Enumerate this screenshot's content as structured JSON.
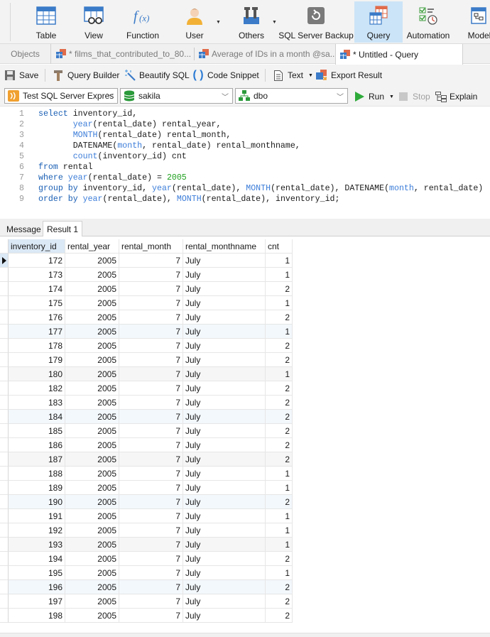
{
  "ribbon": {
    "items": [
      {
        "label": "Table",
        "icon": "table-icon"
      },
      {
        "label": "View",
        "icon": "view-icon"
      },
      {
        "label": "Function",
        "icon": "function-icon"
      },
      {
        "label": "User",
        "icon": "user-icon"
      },
      {
        "label": "Others",
        "icon": "others-icon"
      },
      {
        "label": "SQL Server Backup",
        "icon": "backup-icon"
      },
      {
        "label": "Query",
        "icon": "query-icon"
      },
      {
        "label": "Automation",
        "icon": "automation-icon"
      },
      {
        "label": "Model",
        "icon": "model-icon"
      }
    ],
    "active": "Query"
  },
  "tabs": {
    "objects": "Objects",
    "items": [
      {
        "label": "* films_that_contributed_to_80..."
      },
      {
        "label": "Average of IDs in a month @sa..."
      },
      {
        "label": "* Untitled - Query"
      }
    ]
  },
  "toolbar": {
    "save": "Save",
    "query_builder": "Query Builder",
    "beautify": "Beautify SQL",
    "snippet": "Code Snippet",
    "text": "Text",
    "export": "Export Result"
  },
  "connection": {
    "server": "Test SQL Server Expres",
    "database": "sakila",
    "schema": "dbo",
    "run": "Run",
    "stop": "Stop",
    "explain": "Explain"
  },
  "editor": {
    "line_numbers": [
      "1",
      "2",
      "3",
      "4",
      "5",
      "6",
      "7",
      "8",
      "9"
    ]
  },
  "results": {
    "tabs": [
      "Message",
      "Result 1"
    ],
    "active_tab": "Result 1",
    "columns": [
      "inventory_id",
      "rental_year",
      "rental_month",
      "rental_monthname",
      "cnt"
    ],
    "rows": [
      [
        "172",
        "2005",
        "7",
        "July",
        "1"
      ],
      [
        "173",
        "2005",
        "7",
        "July",
        "1"
      ],
      [
        "174",
        "2005",
        "7",
        "July",
        "2"
      ],
      [
        "175",
        "2005",
        "7",
        "July",
        "1"
      ],
      [
        "176",
        "2005",
        "7",
        "July",
        "2"
      ],
      [
        "177",
        "2005",
        "7",
        "July",
        "1"
      ],
      [
        "178",
        "2005",
        "7",
        "July",
        "2"
      ],
      [
        "179",
        "2005",
        "7",
        "July",
        "2"
      ],
      [
        "180",
        "2005",
        "7",
        "July",
        "1"
      ],
      [
        "182",
        "2005",
        "7",
        "July",
        "2"
      ],
      [
        "183",
        "2005",
        "7",
        "July",
        "2"
      ],
      [
        "184",
        "2005",
        "7",
        "July",
        "2"
      ],
      [
        "185",
        "2005",
        "7",
        "July",
        "2"
      ],
      [
        "186",
        "2005",
        "7",
        "July",
        "2"
      ],
      [
        "187",
        "2005",
        "7",
        "July",
        "2"
      ],
      [
        "188",
        "2005",
        "7",
        "July",
        "1"
      ],
      [
        "189",
        "2005",
        "7",
        "July",
        "1"
      ],
      [
        "190",
        "2005",
        "7",
        "July",
        "2"
      ],
      [
        "191",
        "2005",
        "7",
        "July",
        "1"
      ],
      [
        "192",
        "2005",
        "7",
        "July",
        "1"
      ],
      [
        "193",
        "2005",
        "7",
        "July",
        "1"
      ],
      [
        "194",
        "2005",
        "7",
        "July",
        "2"
      ],
      [
        "195",
        "2005",
        "7",
        "July",
        "1"
      ],
      [
        "196",
        "2005",
        "7",
        "July",
        "2"
      ],
      [
        "197",
        "2005",
        "7",
        "July",
        "2"
      ],
      [
        "198",
        "2005",
        "7",
        "July",
        "2"
      ]
    ]
  },
  "colors": {
    "keyword": "#1a5fb4",
    "function": "#3c7dd9",
    "number": "#1ea01e",
    "ribbon_active": "#cce4f7",
    "run_green": "#2eaa3a"
  }
}
